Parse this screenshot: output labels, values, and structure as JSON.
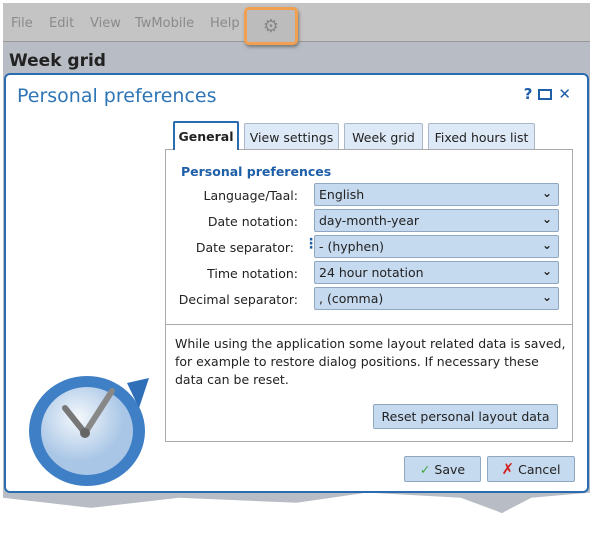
{
  "menubar": {
    "items": [
      "File",
      "Edit",
      "View",
      "TwMobile",
      "Help"
    ],
    "settings_icon": "gear-icon"
  },
  "page_title": "Week grid",
  "dialog": {
    "title": "Personal preferences",
    "help": "?",
    "tabs": [
      "General",
      "View settings",
      "Week grid",
      "Fixed hours list"
    ],
    "active_tab": "General",
    "section_title": "Personal preferences",
    "fields": [
      {
        "label": "Language/Taal:",
        "value": "English"
      },
      {
        "label": "Date notation:",
        "value": "day-month-year"
      },
      {
        "label": "Date separator:",
        "value": " - (hyphen)"
      },
      {
        "label": "Time notation:",
        "value": "24 hour notation"
      },
      {
        "label": "Decimal separator:",
        "value": " , (comma)"
      }
    ],
    "info_text": "While using the application some layout related data is saved, for example to restore dialog positions. If necessary these data can be reset.",
    "reset_label": "Reset personal layout data",
    "save_label": "Save",
    "cancel_label": "Cancel"
  },
  "colors": {
    "accent": "#2b6cb0",
    "highlight": "#f0a050",
    "field_bg": "#c5d9ef"
  }
}
